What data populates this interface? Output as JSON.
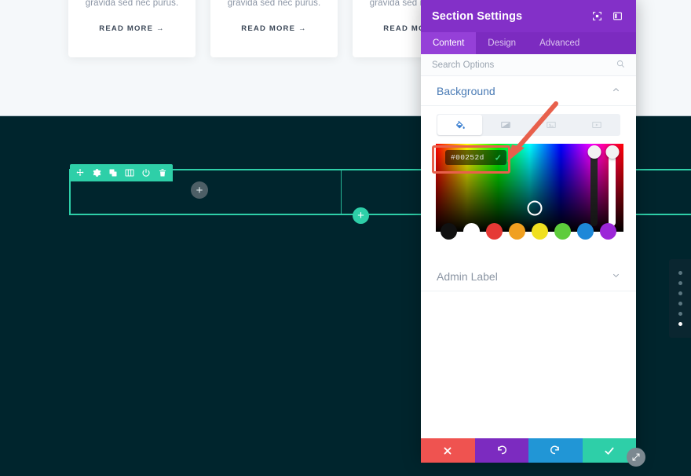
{
  "canvas": {
    "cards": [
      {
        "text": "gravida sed nec purus.",
        "link": "READ MORE →"
      },
      {
        "text": "gravida sed nec purus.",
        "link": "READ MORE →"
      },
      {
        "text": "gravida sed nec purus.",
        "link": "READ MORE →"
      }
    ],
    "section_bg_color": "#00252d",
    "accent_color": "#2ecfa8",
    "toolbar_icons": [
      "move-icon",
      "gear-icon",
      "duplicate-icon",
      "columns-icon",
      "power-icon",
      "trash-icon"
    ],
    "add_module_label": "+",
    "add_section_label": "+",
    "dots": {
      "count": 6,
      "active_index": 5
    }
  },
  "panel": {
    "title": "Section Settings",
    "header_icons": [
      "expand-icon",
      "layout-icon"
    ],
    "header_color": "#8330c8",
    "tabs": [
      {
        "label": "Content",
        "active": true
      },
      {
        "label": "Design",
        "active": false
      },
      {
        "label": "Advanced",
        "active": false
      }
    ],
    "search": {
      "placeholder": "Search Options",
      "value": ""
    },
    "sections": [
      {
        "label": "Background",
        "expanded": true
      },
      {
        "label": "Admin Label",
        "expanded": false
      }
    ],
    "background": {
      "tabs": [
        {
          "name": "color-fill-icon",
          "active": true
        },
        {
          "name": "gradient-icon",
          "active": false
        },
        {
          "name": "image-icon",
          "active": false
        },
        {
          "name": "video-icon",
          "active": false
        }
      ],
      "hex_value": "#00252d",
      "hex_confirm": "✓",
      "swatches": [
        "#111111",
        "#ffffff",
        "#e53935",
        "#f0a020",
        "#f0e020",
        "#5ecc3c",
        "#1e88d8",
        "#9c27d8"
      ]
    }
  },
  "actions": [
    {
      "name": "cancel-button",
      "icon": "close-icon",
      "color": "#ef5350"
    },
    {
      "name": "undo-button",
      "icon": "undo-icon",
      "color": "#7c2bc0"
    },
    {
      "name": "redo-button",
      "icon": "redo-icon",
      "color": "#2196d6"
    },
    {
      "name": "save-button",
      "icon": "check-icon",
      "color": "#2ecfa8"
    }
  ],
  "annotation": {
    "highlight_color": "#e8604c"
  }
}
